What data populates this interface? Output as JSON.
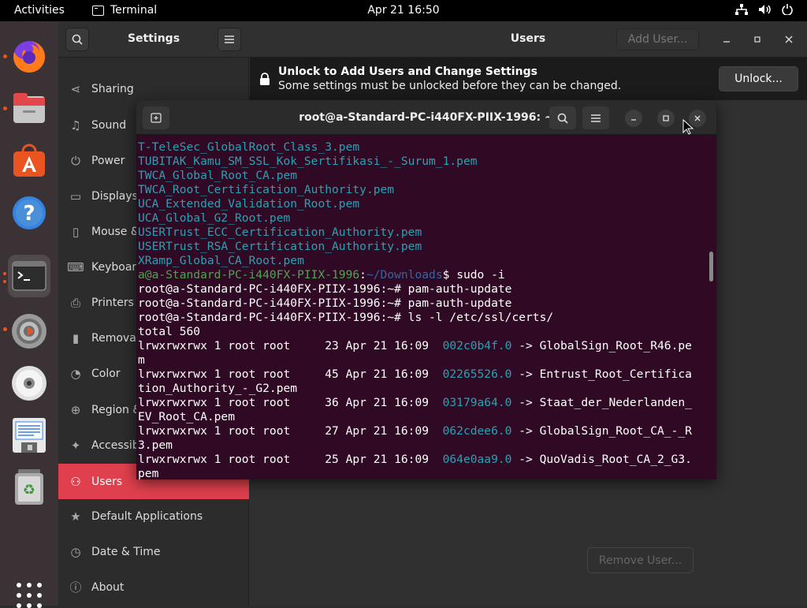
{
  "topbar": {
    "activities": "Activities",
    "app_name": "Terminal",
    "clock": "Apr 21  16:50"
  },
  "dock": {
    "items": [
      {
        "name": "firefox",
        "icon": "firefox-icon"
      },
      {
        "name": "files",
        "icon": "files-icon"
      },
      {
        "name": "software",
        "icon": "software-icon"
      },
      {
        "name": "help",
        "icon": "help-icon"
      },
      {
        "name": "terminal",
        "icon": "terminal-icon"
      },
      {
        "name": "settings",
        "icon": "settings-icon"
      },
      {
        "name": "disc",
        "icon": "disc-icon"
      },
      {
        "name": "text-editor",
        "icon": "text-editor-icon"
      },
      {
        "name": "trash",
        "icon": "trash-icon"
      }
    ]
  },
  "settings": {
    "title": "Settings",
    "users_title": "Users",
    "add_user": "Add User...",
    "remove_user": "Remove User...",
    "banner": {
      "title": "Unlock to Add Users and Change Settings",
      "subtitle": "Some settings must be unlocked before they can be changed.",
      "unlock": "Unlock..."
    },
    "sidebar": [
      {
        "label": "Sharing",
        "icon": "share-icon"
      },
      {
        "label": "Sound",
        "icon": "music-note-icon"
      },
      {
        "label": "Power",
        "icon": "power-icon"
      },
      {
        "label": "Displays",
        "icon": "display-icon"
      },
      {
        "label": "Mouse &",
        "icon": "mouse-icon"
      },
      {
        "label": "Keyboar",
        "icon": "keyboard-icon"
      },
      {
        "label": "Printers",
        "icon": "printer-icon"
      },
      {
        "label": "Removal",
        "icon": "removable-media-icon"
      },
      {
        "label": "Color",
        "icon": "color-icon"
      },
      {
        "label": "Region &",
        "icon": "globe-icon"
      },
      {
        "label": "Accessib",
        "icon": "accessibility-icon"
      },
      {
        "label": "Users",
        "icon": "users-icon"
      },
      {
        "label": "Default Applications",
        "icon": "star-icon"
      },
      {
        "label": "Date & Time",
        "icon": "clock-icon"
      },
      {
        "label": "About",
        "icon": "info-icon"
      }
    ]
  },
  "terminal": {
    "title": "root@a-Standard-PC-i440FX-PIIX-1996: ~",
    "lines": [
      {
        "segments": [
          {
            "t": "T-TeleSec_GlobalRoot_Class_3.pem",
            "c": "cyan"
          }
        ]
      },
      {
        "segments": [
          {
            "t": "TUBITAK_Kamu_SM_SSL_Kok_Sertifikasi_-_Surum_1.pem",
            "c": "cyan"
          }
        ]
      },
      {
        "segments": [
          {
            "t": "TWCA_Global_Root_CA.pem",
            "c": "cyan"
          }
        ]
      },
      {
        "segments": [
          {
            "t": "TWCA_Root_Certification_Authority.pem",
            "c": "cyan"
          }
        ]
      },
      {
        "segments": [
          {
            "t": "UCA_Extended_Validation_Root.pem",
            "c": "cyan"
          }
        ]
      },
      {
        "segments": [
          {
            "t": "UCA_Global_G2_Root.pem",
            "c": "cyan"
          }
        ]
      },
      {
        "segments": [
          {
            "t": "USERTrust_ECC_Certification_Authority.pem",
            "c": "cyan"
          }
        ]
      },
      {
        "segments": [
          {
            "t": "USERTrust_RSA_Certification_Authority.pem",
            "c": "cyan"
          }
        ]
      },
      {
        "segments": [
          {
            "t": "XRamp_Global_CA_Root.pem",
            "c": "cyan"
          }
        ]
      },
      {
        "segments": [
          {
            "t": "a@a-Standard-PC-i440FX-PIIX-1996",
            "c": "green"
          },
          {
            "t": ":",
            "c": ""
          },
          {
            "t": "~/Downloads",
            "c": "blue"
          },
          {
            "t": "$ sudo -i",
            "c": ""
          }
        ]
      },
      {
        "segments": [
          {
            "t": "root@a-Standard-PC-i440FX-PIIX-1996:~# pam-auth-update",
            "c": ""
          }
        ]
      },
      {
        "segments": [
          {
            "t": "root@a-Standard-PC-i440FX-PIIX-1996:~# pam-auth-update",
            "c": ""
          }
        ]
      },
      {
        "segments": [
          {
            "t": "root@a-Standard-PC-i440FX-PIIX-1996:~# ls -l /etc/ssl/certs/",
            "c": ""
          }
        ]
      },
      {
        "segments": [
          {
            "t": "total 560",
            "c": ""
          }
        ]
      },
      {
        "segments": [
          {
            "t": "lrwxrwxrwx 1 root root     23 Apr 21 16:09  ",
            "c": ""
          },
          {
            "t": "002c0b4f.0",
            "c": "cyan"
          },
          {
            "t": " -> GlobalSign_Root_R46.pe",
            "c": ""
          }
        ]
      },
      {
        "segments": [
          {
            "t": "m",
            "c": ""
          }
        ]
      },
      {
        "segments": [
          {
            "t": "lrwxrwxrwx 1 root root     45 Apr 21 16:09  ",
            "c": ""
          },
          {
            "t": "02265526.0",
            "c": "cyan"
          },
          {
            "t": " -> Entrust_Root_Certifica",
            "c": ""
          }
        ]
      },
      {
        "segments": [
          {
            "t": "tion_Authority_-_G2.pem",
            "c": ""
          }
        ]
      },
      {
        "segments": [
          {
            "t": "lrwxrwxrwx 1 root root     36 Apr 21 16:09  ",
            "c": ""
          },
          {
            "t": "03179a64.0",
            "c": "cyan"
          },
          {
            "t": " -> Staat_der_Nederlanden_",
            "c": ""
          }
        ]
      },
      {
        "segments": [
          {
            "t": "EV_Root_CA.pem",
            "c": ""
          }
        ]
      },
      {
        "segments": [
          {
            "t": "lrwxrwxrwx 1 root root     27 Apr 21 16:09  ",
            "c": ""
          },
          {
            "t": "062cdee6.0",
            "c": "cyan"
          },
          {
            "t": " -> GlobalSign_Root_CA_-_R",
            "c": ""
          }
        ]
      },
      {
        "segments": [
          {
            "t": "3.pem",
            "c": ""
          }
        ]
      },
      {
        "segments": [
          {
            "t": "lrwxrwxrwx 1 root root     25 Apr 21 16:09  ",
            "c": ""
          },
          {
            "t": "064e0aa9.0",
            "c": "cyan"
          },
          {
            "t": " -> QuoVadis_Root_CA_2_G3.",
            "c": ""
          }
        ]
      },
      {
        "segments": [
          {
            "t": "pem",
            "c": ""
          }
        ]
      }
    ]
  }
}
